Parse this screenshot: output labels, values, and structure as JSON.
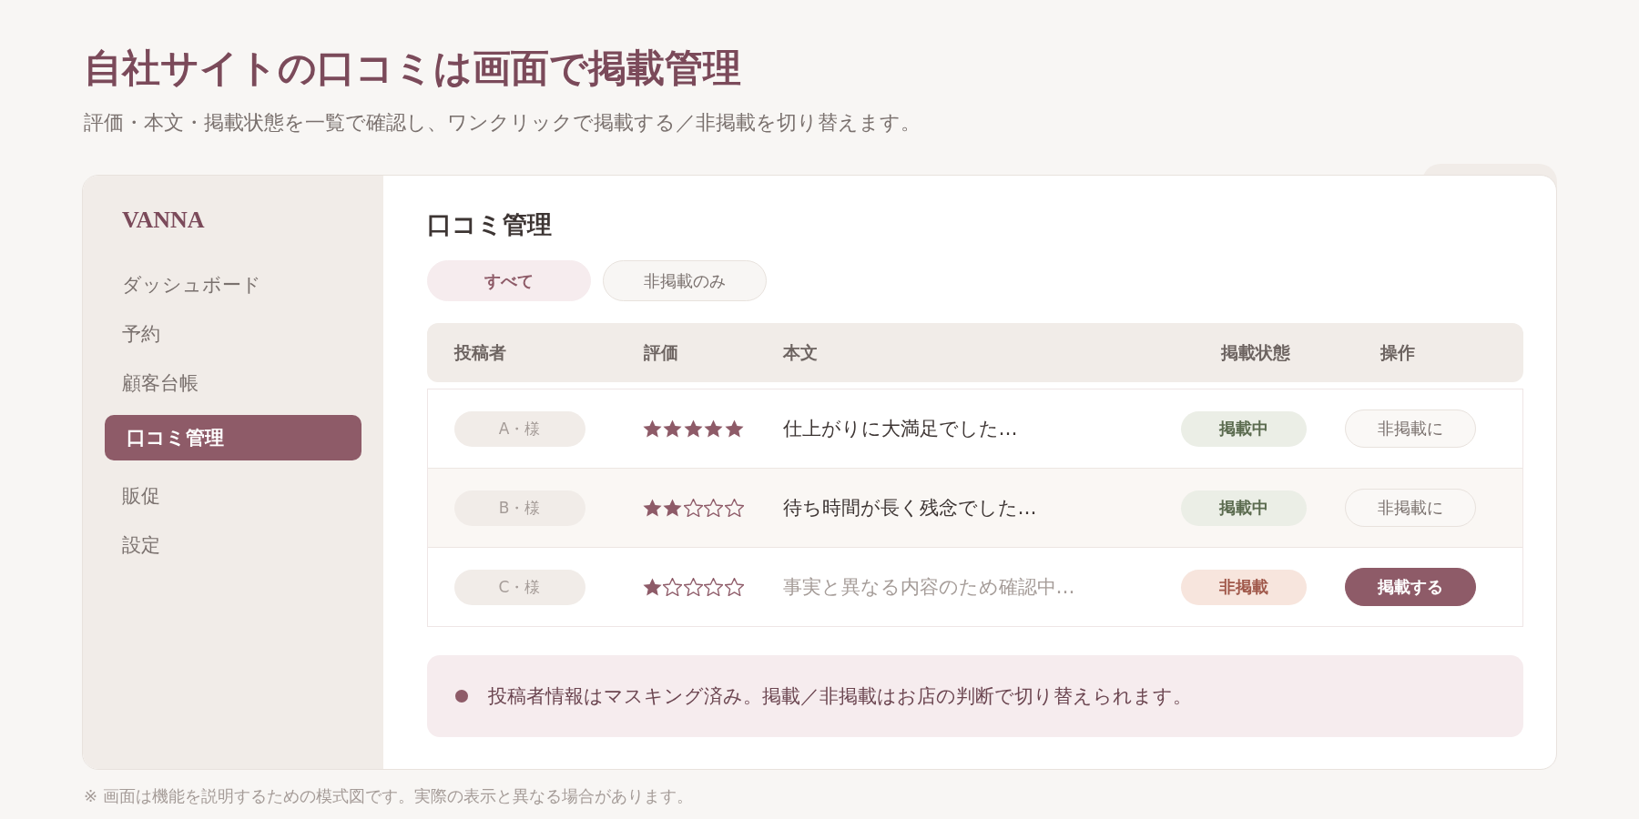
{
  "header": {
    "title": "自社サイトの口コミは画面で掲載管理",
    "subtitle": "評価・本文・掲載状態を一覧で確認し、ワンクリックで掲載する／非掲載を切り替えます。"
  },
  "sidebar": {
    "brand": "VANNA",
    "items": [
      {
        "label": "ダッシュボード",
        "selected": false
      },
      {
        "label": "予約",
        "selected": false
      },
      {
        "label": "顧客台帳",
        "selected": false
      },
      {
        "label": "口コミ管理",
        "selected": true
      },
      {
        "label": "販促",
        "selected": false
      },
      {
        "label": "設定",
        "selected": false
      }
    ]
  },
  "main": {
    "title": "口コミ管理",
    "filters": [
      {
        "label": "すべて",
        "selected": true
      },
      {
        "label": "非掲載のみ",
        "selected": false
      }
    ],
    "table": {
      "columns": [
        "投稿者",
        "評価",
        "本文",
        "掲載状態",
        "操作"
      ],
      "rows": [
        {
          "author": "A・様",
          "stars": 5,
          "text": "仕上がりに大満足でした…",
          "published": true,
          "status": "掲載中",
          "action": "非掲載に"
        },
        {
          "author": "B・様",
          "stars": 2,
          "text": "待ち時間が長く残念でした…",
          "published": true,
          "status": "掲載中",
          "action": "非掲載に"
        },
        {
          "author": "C・様",
          "stars": 1,
          "text": "事実と異なる内容のため確認中…",
          "published": false,
          "status": "非掲載",
          "action": "掲載する"
        }
      ]
    },
    "note": {
      "text": "投稿者情報はマスキング済み。掲載／非掲載はお店の判断で切り替えられます。"
    }
  },
  "footnote": "※ 画面は機能を説明するための模式図です。実際の表示と異なる場合があります。"
}
